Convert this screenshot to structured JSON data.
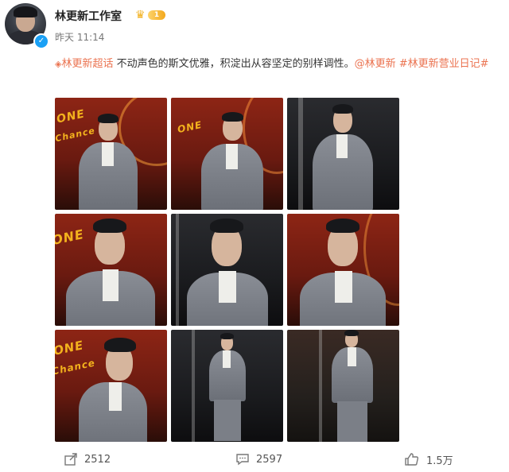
{
  "account": {
    "name": "林更新工作室",
    "vip_level": "1",
    "time": "昨天 11:14"
  },
  "post": {
    "topic_prefix": "林更新超话",
    "body": " 不动声色的斯文优雅，积淀出从容坚定的别样调性。",
    "mention": "@林更新",
    "hashtag": "#林更新营业日记#"
  },
  "photos": [
    {
      "id": "1",
      "style": "red"
    },
    {
      "id": "2",
      "style": "red"
    },
    {
      "id": "3",
      "style": "dark"
    },
    {
      "id": "4",
      "style": "red"
    },
    {
      "id": "5",
      "style": "dark"
    },
    {
      "id": "6",
      "style": "red"
    },
    {
      "id": "7",
      "style": "red"
    },
    {
      "id": "8",
      "style": "dark"
    },
    {
      "id": "9",
      "style": "darkred"
    }
  ],
  "stats": {
    "reposts": "2512",
    "comments": "2597",
    "likes": "1.5万"
  },
  "colors": {
    "link": "#eb7350",
    "verified": "#1aa0f5",
    "vip_gold": "#f2b01e"
  },
  "icons": [
    "verified-icon",
    "crown-icon",
    "super-topic-icon",
    "repost-icon",
    "comment-icon",
    "like-icon"
  ]
}
